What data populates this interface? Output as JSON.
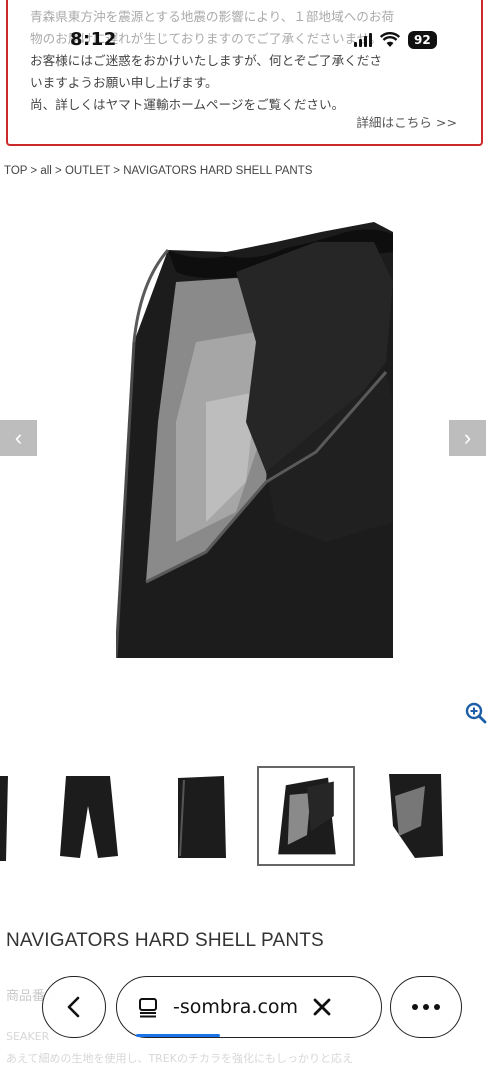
{
  "status_bar": {
    "time": "8:12",
    "battery": "92"
  },
  "notice": {
    "lines": [
      "青森県東方沖を震源とする地震の影響により、１部地域へのお荷",
      "物のお届けに遅れが生じておりますのでご了承くださいませ。",
      "お客様にはご迷惑をおかけいたしますが、何とぞご了承くださ",
      "いますようお願い申し上げます。",
      "尚、詳しくはヤマト運輸ホームページをご覧ください。"
    ],
    "link": "詳細はこちら >>"
  },
  "breadcrumb": "TOP > all > OUTLET > NAVIGATORS HARD SHELL PANTS",
  "gallery": {
    "prev": "‹",
    "next": "›",
    "zoom_icon": "zoom-in-icon"
  },
  "product": {
    "title": "NAVIGATORS HARD SHELL PANTS",
    "faded_label": "商品番号",
    "faded_desc_1": "SEAKER",
    "faded_desc_2": "あえて細めの生地を使用し、TREKのチカラを強化にもしっかりと応え"
  },
  "browser": {
    "url": "-sombra.com",
    "back_icon": "chevron-left-icon",
    "tabs_icon": "tabs-icon",
    "close_icon": "close-icon",
    "more_icon": "more-dots-icon"
  }
}
